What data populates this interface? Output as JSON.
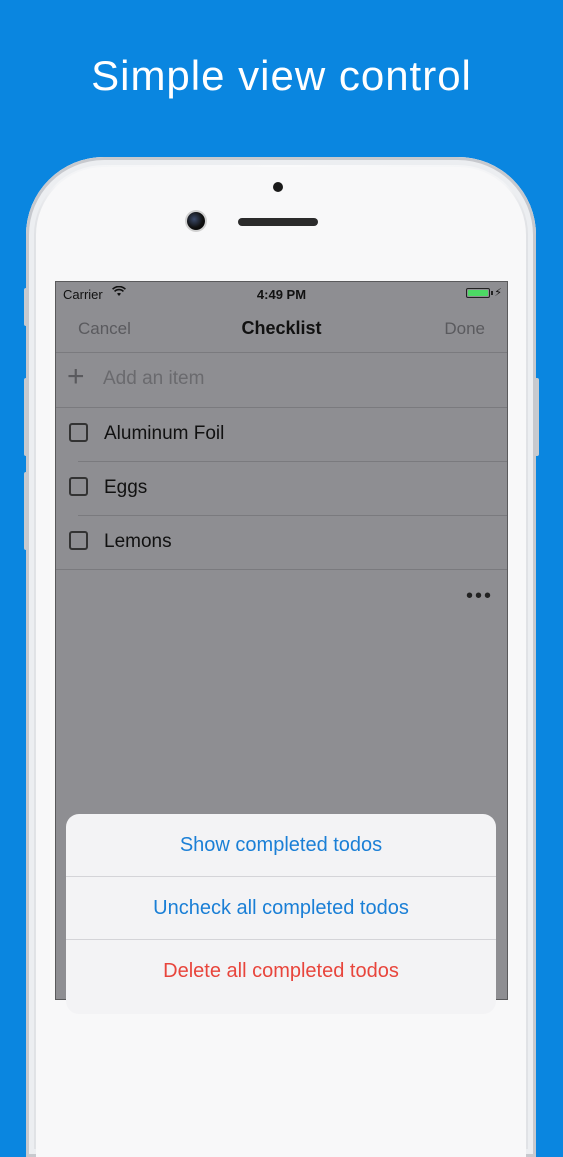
{
  "headline": "Simple view control",
  "status_bar": {
    "carrier": "Carrier",
    "time": "4:49 PM",
    "battery_color": "#4cd964"
  },
  "nav": {
    "cancel_label": "Cancel",
    "title": "Checklist",
    "done_label": "Done"
  },
  "add_item": {
    "placeholder": "Add an item",
    "icon": "plus-icon"
  },
  "todos": [
    {
      "label": "Aluminum Foil",
      "checked": false
    },
    {
      "label": "Eggs",
      "checked": false
    },
    {
      "label": "Lemons",
      "checked": false
    }
  ],
  "more_icon": "more-horizontal-icon",
  "action_sheet": {
    "items": [
      {
        "label": "Show completed todos",
        "color": "#1a7fd6"
      },
      {
        "label": "Uncheck all completed todos",
        "color": "#1a7fd6"
      },
      {
        "label": "Delete all completed todos",
        "color": "#e8453c"
      }
    ]
  },
  "colors": {
    "background": "#0a86e0",
    "dim_overlay": "#8e8e92"
  }
}
